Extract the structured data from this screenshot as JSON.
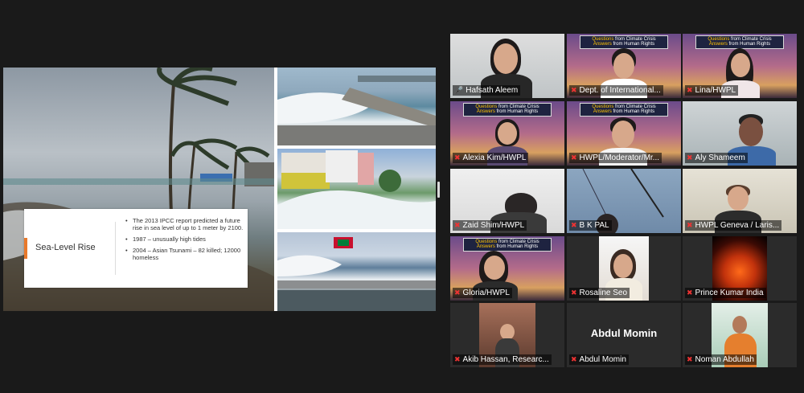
{
  "slide": {
    "title": "Sea-Level Rise",
    "bullets": [
      "The 2013 IPCC report predicted a future rise in sea level of up to 1 meter by 2100.",
      "1987 – unusually high tides",
      "2004 – Asian Tsunami – 82 killed; 12000 homeless"
    ]
  },
  "banner": {
    "line1_a": "Questions",
    "line1_b": " from Climate Crisis",
    "line2_a": "Answers",
    "line2_b": " from Human Rights"
  },
  "participants": [
    {
      "name": "Hafsath Aleem",
      "muted": false
    },
    {
      "name": "Dept. of International...",
      "muted": true
    },
    {
      "name": "Lina/HWPL",
      "muted": true
    },
    {
      "name": "Alexia Kim/HWPL",
      "muted": true
    },
    {
      "name": "HWPL/Moderator/Mr...",
      "muted": true
    },
    {
      "name": "Aly Shameem",
      "muted": true
    },
    {
      "name": "Zaid Shim/HWPL",
      "muted": true
    },
    {
      "name": "B K PAL",
      "muted": true
    },
    {
      "name": "HWPL Geneva / Laris...",
      "muted": true
    },
    {
      "name": "Gloria/HWPL",
      "muted": true
    },
    {
      "name": "Rosaline Seo",
      "muted": true
    },
    {
      "name": "Prince Kumar India",
      "muted": true
    },
    {
      "name": "Akib Hassan, Researc...",
      "muted": true
    },
    {
      "name": "Abdul Momin",
      "muted": true
    },
    {
      "name": "Noman Abdullah",
      "muted": true
    }
  ],
  "video_off_name": "Abdul Momin",
  "colors": {
    "active_border": "#c5e24a",
    "mic_muted": "#e33333",
    "slide_accent": "#e8792b"
  }
}
